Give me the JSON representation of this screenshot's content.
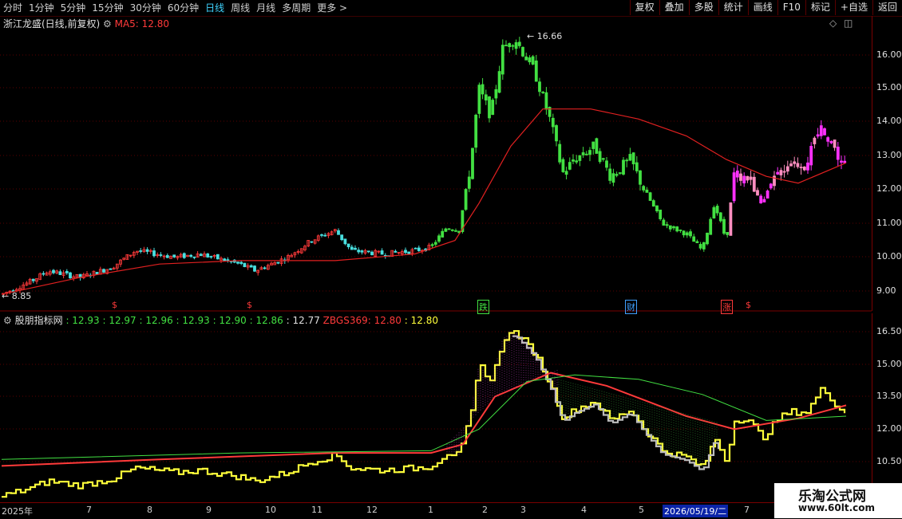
{
  "toolbar": {
    "periods": [
      "分时",
      "1分钟",
      "5分钟",
      "15分钟",
      "30分钟",
      "60分钟",
      "日线",
      "周线",
      "月线",
      "多周期",
      "更多 >"
    ],
    "active_period": "日线",
    "actions": [
      "复权",
      "叠加",
      "多股",
      "统计",
      "画线",
      "F10",
      "标记",
      "+自选",
      "返回"
    ]
  },
  "main_chart": {
    "title": "浙江龙盛(日线,前复权)",
    "ma_label": "MA5: 12.80",
    "y_ticks": [
      "16.00",
      "15.00",
      "14.00",
      "13.00",
      "12.00",
      "11.00",
      "10.00",
      "9.00"
    ],
    "high_label": "16.66",
    "low_label": "8.85",
    "events": [
      {
        "text": "$",
        "color": "#ff3a3a"
      },
      {
        "text": "$",
        "color": "#ff3a3a"
      },
      {
        "text": "跌",
        "color": "#42e042"
      },
      {
        "text": "财",
        "color": "#3fa0ff"
      },
      {
        "text": "涨",
        "color": "#ff3a3a"
      },
      {
        "text": "$",
        "color": "#ff3a3a"
      }
    ]
  },
  "indicator": {
    "name": "股朋指标网",
    "values": [
      ": 12.93",
      ": 12.97",
      ": 12.96",
      ": 12.93",
      ": 12.90",
      ": 12.86",
      ": 12.77"
    ],
    "zbgs": "ZBGS369: 12.80",
    "last": ": 12.80",
    "y_ticks": [
      "16.50",
      "15.00",
      "13.50",
      "12.00",
      "10.50"
    ]
  },
  "date_axis": {
    "labels": [
      "2025年",
      "7",
      "8",
      "9",
      "10",
      "11",
      "12",
      "1",
      "2",
      "3",
      "4",
      "5",
      "2026/05/19/二",
      "7"
    ]
  },
  "watermark": {
    "line1": "乐淘公式网",
    "line2": "www.60lt.com"
  },
  "colors": {
    "up": "#ff3a3a",
    "down": "#42e042",
    "ma": "#e02020",
    "accent": "#3fd4ff",
    "magenta": "#ff30ff",
    "yellow": "#ffff3a"
  },
  "chart_data": {
    "type": "line",
    "title": "浙江龙盛(日线,前复权)",
    "x": [
      "2025年",
      "7",
      "8",
      "9",
      "10",
      "11",
      "12",
      "1",
      "2",
      "3",
      "4",
      "5",
      "2026/05/19/二",
      "7"
    ],
    "ylim": [
      8.5,
      17.0
    ],
    "series": [
      {
        "name": "MA5",
        "values": [
          8.9,
          9.2,
          9.6,
          9.8,
          9.9,
          9.9,
          10.1,
          10.3,
          11.0,
          13.8,
          14.4,
          13.9,
          12.8,
          12.8
        ]
      }
    ]
  }
}
